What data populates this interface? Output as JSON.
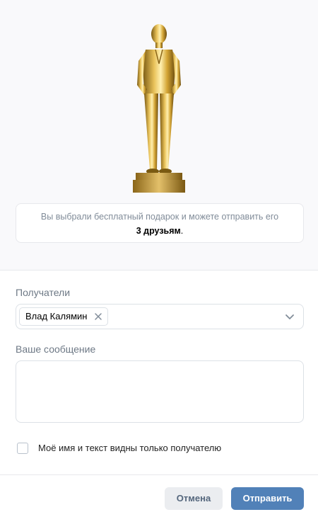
{
  "gift": {
    "info_text": "Вы выбрали бесплатный подарок и можете отправить его",
    "friends_count": "3 друзьям",
    "period": "."
  },
  "recipients": {
    "label": "Получатели",
    "chips": [
      {
        "name": "Влад Калямин"
      }
    ]
  },
  "message": {
    "label": "Ваше сообщение",
    "value": ""
  },
  "privacy": {
    "label": "Моё имя и текст видны только получателю",
    "checked": false
  },
  "buttons": {
    "cancel": "Отмена",
    "send": "Отправить"
  },
  "colors": {
    "accent": "#5181b8",
    "gold": "#c9a227"
  }
}
